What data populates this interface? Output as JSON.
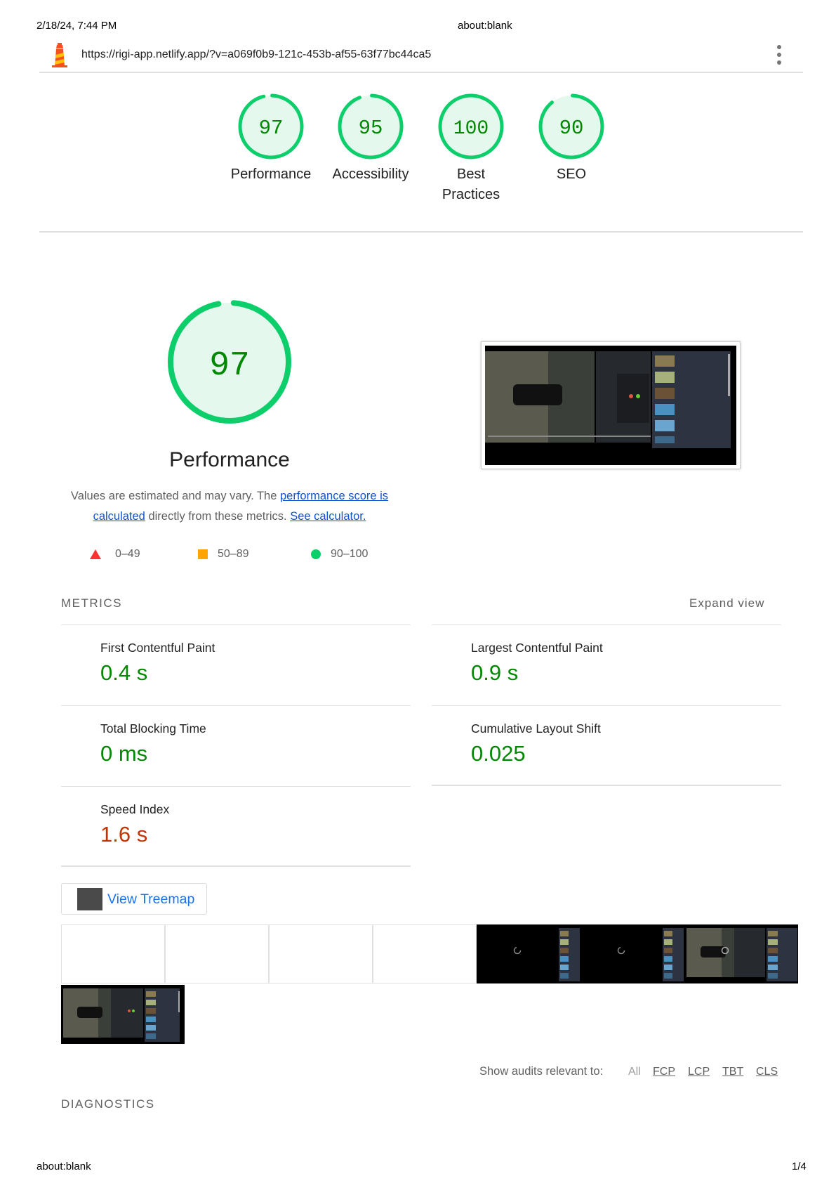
{
  "print_header": {
    "datetime": "2/18/24, 7:44 PM",
    "page_title": "about:blank"
  },
  "print_footer": {
    "url": "about:blank",
    "page": "1/4"
  },
  "url_bar": {
    "url": "https://rigi-app.netlify.app/?v=a069f0b9-121c-453b-af55-63f77bc44ca5"
  },
  "colors": {
    "pass": "#0cce6b",
    "pass_text": "#008800",
    "pass_fill": "#e5f8ee",
    "fail": "#ff3333",
    "average_text": "#c33300",
    "link": "#1155cc"
  },
  "scores": [
    {
      "value": 97,
      "label": "Performance"
    },
    {
      "value": 95,
      "label": "Accessibility"
    },
    {
      "value": 100,
      "label": "Best Practices"
    },
    {
      "value": 90,
      "label": "SEO"
    }
  ],
  "performance": {
    "score": 97,
    "title": "Performance",
    "desc_prefix": "Values are estimated and may vary. The ",
    "desc_link1": "performance score is calculated",
    "desc_middle": " directly from these metrics. ",
    "desc_link2": "See calculator.",
    "legend": {
      "fail": "0–49",
      "average": "50–89",
      "pass": "90–100"
    }
  },
  "metrics_section": {
    "heading": "METRICS",
    "expand": "Expand view"
  },
  "metrics": [
    {
      "title": "First Contentful Paint",
      "value": "0.4 s",
      "status": "pass"
    },
    {
      "title": "Largest Contentful Paint",
      "value": "0.9 s",
      "status": "pass"
    },
    {
      "title": "Total Blocking Time",
      "value": "0 ms",
      "status": "pass"
    },
    {
      "title": "Cumulative Layout Shift",
      "value": "0.025",
      "status": "pass"
    },
    {
      "title": "Speed Index",
      "value": "1.6 s",
      "status": "average"
    }
  ],
  "treemap": {
    "label": "View Treemap"
  },
  "audit_filter": {
    "label": "Show audits relevant to:",
    "all": "All",
    "links": [
      "FCP",
      "LCP",
      "TBT",
      "CLS"
    ]
  },
  "diagnostics": {
    "heading": "DIAGNOSTICS"
  }
}
